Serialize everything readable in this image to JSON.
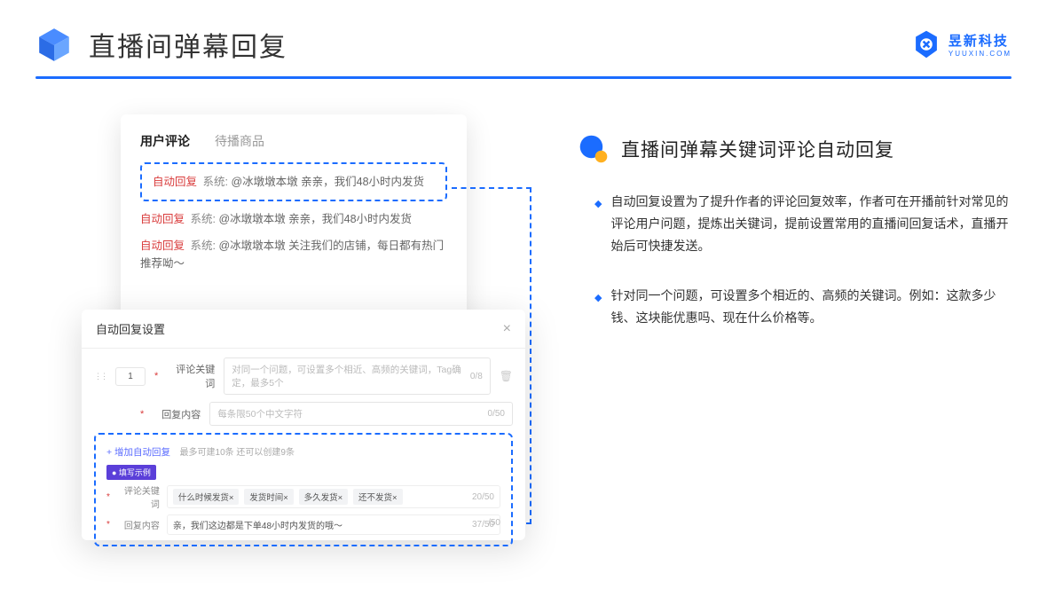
{
  "header": {
    "title": "直播间弹幕回复",
    "brand_name": "昱新科技",
    "brand_url": "YUUXIN.COM"
  },
  "comments_card": {
    "tab_active": "用户评论",
    "tab_inactive": "待播商品",
    "highlighted": {
      "tag": "自动回复",
      "system": "系统:",
      "text": "@冰墩墩本墩 亲亲，我们48小时内发货"
    },
    "line2": {
      "tag": "自动回复",
      "system": "系统:",
      "text": "@冰墩墩本墩 亲亲，我们48小时内发货"
    },
    "line3": {
      "tag": "自动回复",
      "system": "系统:",
      "text": "@冰墩墩本墩 关注我们的店铺，每日都有热门推荐呦～"
    }
  },
  "settings_card": {
    "title": "自动回复设置",
    "close": "×",
    "row_num": "1",
    "label_keyword": "评论关键词",
    "placeholder_keyword": "对同一个问题，可设置多个相近、高频的关键词，Tag确定，最多5个",
    "counter_keyword": "0/8",
    "label_content": "回复内容",
    "placeholder_content": "每条限50个中文字符",
    "counter_content": "0/50",
    "add_link": "+ 增加自动回复",
    "add_note": "最多可建10条 还可以创建9条",
    "example_badge": "● 填写示例",
    "ex_label_keyword": "评论关键词",
    "ex_chips": [
      "什么时候发货×",
      "发货时间×",
      "多久发货×",
      "还不发货×"
    ],
    "ex_counter_keyword": "20/50",
    "ex_label_content": "回复内容",
    "ex_content_value": "亲，我们这边都是下单48小时内发货的哦～",
    "ex_counter_content": "37/50",
    "extra_counter": "/50"
  },
  "right": {
    "section_title": "直播间弹幕关键词评论自动回复",
    "bullet1": "自动回复设置为了提升作者的评论回复效率，作者可在开播前针对常见的评论用户问题，提炼出关键词，提前设置常用的直播间回复话术，直播开始后可快捷发送。",
    "bullet2": "针对同一个问题，可设置多个相近的、高频的关键词。例如：这款多少钱、这块能优惠吗、现在什么价格等。"
  }
}
